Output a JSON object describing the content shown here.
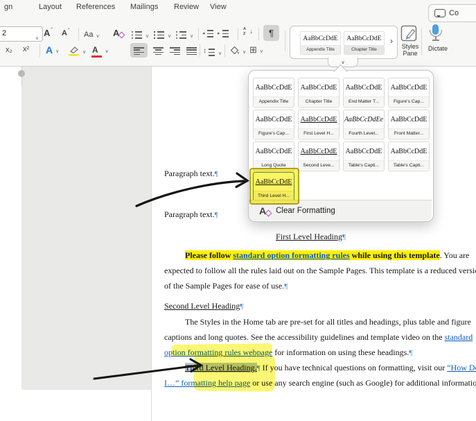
{
  "window": {
    "tabs": [
      "gn",
      "Layout",
      "References",
      "Mailings",
      "Review",
      "View"
    ],
    "comments_label": "Co"
  },
  "ribbon": {
    "font_size": "2",
    "icons": {
      "grow": "A",
      "shrink": "A",
      "case": "Aa",
      "clear": "A",
      "sub": "x₂",
      "sup": "x²",
      "effects": "A",
      "font_color": "A",
      "pilcrow": "¶",
      "borders": "⊞",
      "expand": "›"
    },
    "gallery": [
      {
        "preview": "AaBbCcDdE",
        "label": "Appendix Title"
      },
      {
        "preview": "AaBbCcDdE",
        "label": "Chapter Title"
      }
    ],
    "styles_pane_label_1": "Styles",
    "styles_pane_label_2": "Pane",
    "dictate_label": "Dictate"
  },
  "styles_menu": {
    "items": [
      {
        "preview": "AaBbCcDdE",
        "label": "Appendix Title"
      },
      {
        "preview": "AaBbCcDdE",
        "label": "Chapter Title"
      },
      {
        "preview": "AaBbCcDdE",
        "label": "End Matter T..."
      },
      {
        "preview": "AaBbCcDdE",
        "label": "Figure's Cap..."
      },
      {
        "preview": "AaBbCcDdE",
        "label": "Figure's Cap..."
      },
      {
        "preview": "AaBbCcDdE",
        "label": "First Level H..."
      },
      {
        "preview": "AaBbCcDdEe",
        "label": "Fourth Level..."
      },
      {
        "preview": "AaBbCcDdE",
        "label": "Front Matter..."
      },
      {
        "preview": "AaBbCcDdE",
        "label": "Long Quote"
      },
      {
        "preview": "AaBbCcDdE",
        "label": "Second Leve..."
      },
      {
        "preview": "AaBbCcDdE",
        "label": "Table's Capti..."
      },
      {
        "preview": "AaBbCcDdE",
        "label": "Table's Capti..."
      },
      {
        "preview": "AaBbCcDdE",
        "label": "Third Level H..."
      }
    ],
    "clear_formatting_label": "Clear Formatting"
  },
  "document": {
    "pilcrow": "¶",
    "paragraph_text": "Paragraph text.",
    "heading_first": "First Level Heading",
    "heading_second": "Second Level Heading",
    "intro_l1_a": "Please follow ",
    "intro_l1_link": "standard option formatting rules",
    "intro_l1_b": " while using this template",
    "intro_l1_c": ". You are",
    "intro_l2": "expected to follow all the rules laid out on the Sample Pages. This template is a reduced version",
    "intro_l3": "of the Sample Pages for ease of use.",
    "styles_l1": "The Styles in the Home tab are pre-set for all titles and headings, plus table and figure",
    "styles_l2_a": "captions and long quotes. See the accessibility guidelines and template video on the ",
    "styles_l2_link": "standard",
    "styles_l3_link": "option formatting rules webpage",
    "styles_l3_b": " for information on using these headings.",
    "third_l1_heading": "Third Level Heading.",
    "third_l1_a": " If you have technical questions on formatting, visit our ",
    "third_l1_link": "“How Do",
    "third_l2_link": "I…” formatting help page",
    "third_l2_a": " or use any search engine (such as Google) for additional information."
  },
  "colors": {
    "highlight": "#fdf000",
    "link": "#0b5cc4",
    "marker_yellow": "#f8ee20",
    "accent_blue": "#3f93e0",
    "selection": "#b9c7d7"
  }
}
